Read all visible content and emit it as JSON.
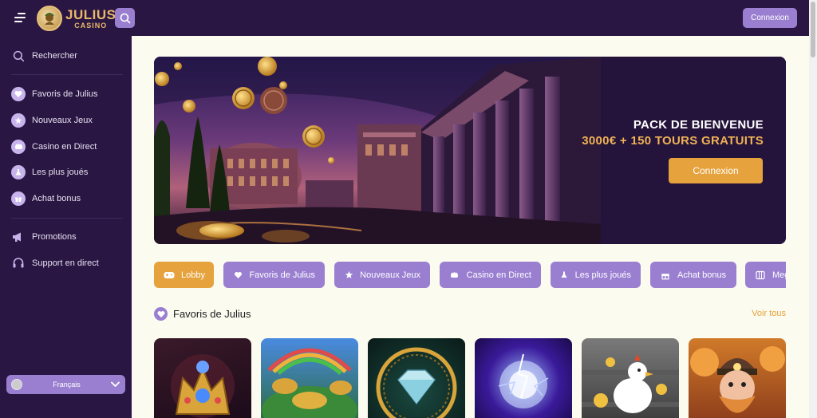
{
  "header": {
    "logo": {
      "line1": "JULIUS",
      "line2": "CASINO"
    },
    "login_label": "Connexion",
    "icons": {
      "menu": "hamburger-icon",
      "search": "search-icon"
    }
  },
  "sidebar": {
    "search_label": "Rechercher",
    "items": [
      {
        "label": "Favoris de Julius",
        "icon": "heart-icon"
      },
      {
        "label": "Nouveaux Jeux",
        "icon": "star-icon"
      },
      {
        "label": "Casino en Direct",
        "icon": "cards-icon"
      },
      {
        "label": "Les plus joués",
        "icon": "flask-icon"
      },
      {
        "label": "Achat bonus",
        "icon": "gift-icon"
      }
    ],
    "secondary": [
      {
        "label": "Promotions",
        "icon": "megaphone-icon"
      },
      {
        "label": "Support en direct",
        "icon": "headset-icon"
      }
    ],
    "language": "Français"
  },
  "banner": {
    "title": "PACK DE BIENVENUE",
    "subtitle": "3000€ + 150 TOURS GRATUITS",
    "cta": "Connexion"
  },
  "tabs": [
    {
      "label": "Lobby",
      "icon": "gamepad-icon",
      "active": true
    },
    {
      "label": "Favoris de Julius",
      "icon": "heart-icon",
      "active": false
    },
    {
      "label": "Nouveaux Jeux",
      "icon": "star-icon",
      "active": false
    },
    {
      "label": "Casino en Direct",
      "icon": "cards-icon",
      "active": false
    },
    {
      "label": "Les plus joués",
      "icon": "flask-icon",
      "active": false
    },
    {
      "label": "Achat bonus",
      "icon": "gift-icon",
      "active": false
    },
    {
      "label": "Meg",
      "icon": "slot-icon",
      "active": false
    }
  ],
  "section": {
    "title": "Favoris de Julius",
    "more_label": "Voir tous"
  },
  "colors": {
    "sidebar_bg": "#2a1642",
    "main_bg": "#fbfbf0",
    "accent_purple": "#9a7fd1",
    "accent_orange": "#e6a23c"
  }
}
